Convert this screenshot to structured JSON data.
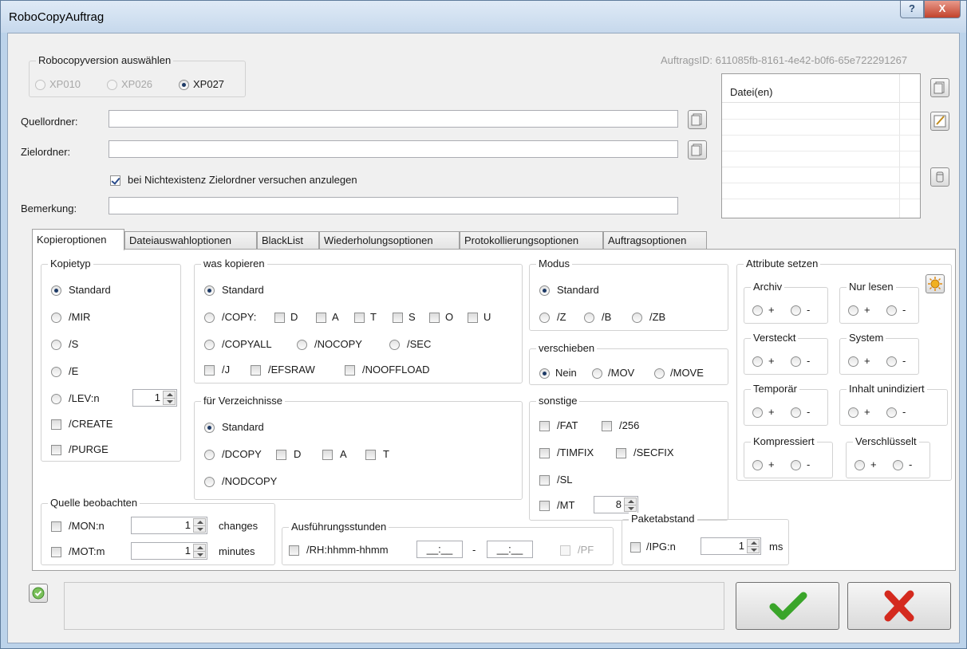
{
  "window": {
    "title": "RoboCopyAuftrag",
    "help_label": "?",
    "close_label": "X"
  },
  "auftrags_id": "AuftragsID: 611085fb-8161-4e42-b0f6-65e722291267",
  "version_group": {
    "title": "Robocopyversion auswählen",
    "options": [
      "XP010",
      "XP026",
      "XP027"
    ],
    "selected": "XP027"
  },
  "quellordner": {
    "label": "Quellordner:",
    "value": ""
  },
  "zielordner": {
    "label": "Zielordner:",
    "value": ""
  },
  "create_target": {
    "label": "bei Nichtexistenz Zielordner versuchen anzulegen",
    "checked": true
  },
  "bemerkung": {
    "label": "Bemerkung:",
    "value": ""
  },
  "files_list": {
    "header": "Datei(en)"
  },
  "tabs": [
    "Kopieroptionen",
    "Dateiauswahloptionen",
    "BlackList",
    "Wiederholungsoptionen",
    "Protokollierungsoptionen",
    "Auftragsoptionen"
  ],
  "active_tab": "Kopieroptionen",
  "kopiertyp": {
    "title": "Kopietyp",
    "radios": [
      "Standard",
      "/MIR",
      "/S",
      "/E",
      "/LEV:n"
    ],
    "lev_value": "1",
    "checks": [
      "/CREATE",
      "/PURGE"
    ]
  },
  "was_kopieren": {
    "title": "was kopieren",
    "standard": "Standard",
    "copy": "/COPY:",
    "copy_flags": [
      "D",
      "A",
      "T",
      "S",
      "O",
      "U"
    ],
    "copyall": "/COPYALL",
    "nocopy": "/NOCOPY",
    "sec": "/SEC",
    "checks": [
      "/J",
      "/EFSRAW",
      "/NOOFFLOAD"
    ]
  },
  "fuer_verzeichnisse": {
    "title": "für Verzeichnisse",
    "standard": "Standard",
    "dcopy": "/DCOPY",
    "dcopy_flags": [
      "D",
      "A",
      "T"
    ],
    "nodcopy": "/NODCOPY"
  },
  "modus": {
    "title": "Modus",
    "standard": "Standard",
    "options": [
      "/Z",
      "/B",
      "/ZB"
    ]
  },
  "verschieben": {
    "title": "verschieben",
    "options": [
      "Nein",
      "/MOV",
      "/MOVE"
    ]
  },
  "sonstige": {
    "title": "sonstige",
    "fat": "/FAT",
    "r256": "/256",
    "timfix": "/TIMFIX",
    "secfix": "/SECFIX",
    "sl": "/SL",
    "mt": "/MT",
    "mt_value": "8"
  },
  "attribute": {
    "title": "Attribute setzen",
    "plus": "+",
    "minus": "-",
    "groups": [
      "Archiv",
      "Nur lesen",
      "Versteckt",
      "System",
      "Temporär",
      "Inhalt unindiziert",
      "Kompressiert",
      "Verschlüsselt"
    ]
  },
  "quelle_beobachten": {
    "title": "Quelle beobachten",
    "mon": {
      "label": "/MON:n",
      "value": "1",
      "unit": "changes"
    },
    "mot": {
      "label": "/MOT:m",
      "value": "1",
      "unit": "minutes"
    }
  },
  "ausfuehrungsstunden": {
    "title": "Ausführungsstunden",
    "rh": "/RH:hhmm-hhmm",
    "from": "__:__",
    "dash": "-",
    "to": "__:__",
    "pf": "/PF"
  },
  "paketabstand": {
    "title": "Paketabstand",
    "ipg": "/IPG:n",
    "value": "1",
    "unit": "ms"
  },
  "colors": {
    "ok_green": "#3aa52a",
    "cancel_red": "#d42a1e",
    "title_bg": "#c6d8ec"
  }
}
